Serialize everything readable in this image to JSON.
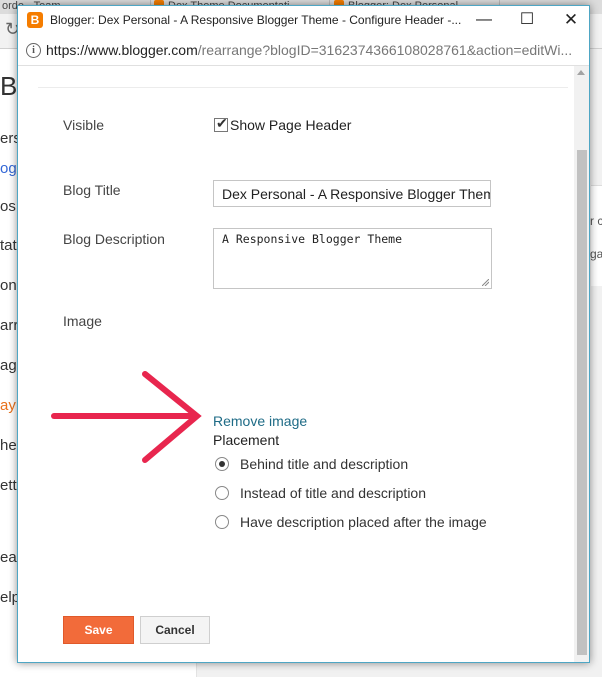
{
  "background": {
    "tabs": [
      "orde - Team",
      "Dex Theme Documentati",
      "Blogger: Dex Personal"
    ],
    "reload_icon": "reload-icon",
    "sidebar": {
      "title": "Bl",
      "items": [
        "ers",
        "og",
        "os",
        "tat",
        "on",
        "arr",
        "ag",
        "ay",
        "he",
        "ett",
        "ea",
        "elp"
      ]
    },
    "right_snippets": [
      "r c",
      "ga"
    ]
  },
  "popup": {
    "window_title": "Blogger: Dex Personal - A Responsive Blogger Theme - Configure Header -...",
    "url_host": "https://www.blogger.com",
    "url_path": "/rearrange?blogID=3162374366108028761&action=editWi...",
    "controls": {
      "minimize": "—",
      "maximize": "☐",
      "close": "✕"
    },
    "icons": {
      "favicon": "blogger-icon",
      "info": "info-icon"
    }
  },
  "form": {
    "visible_label": "Visible",
    "show_header_label": "Show Page Header",
    "show_header_checked": true,
    "blog_title_label": "Blog Title",
    "blog_title_value": "Dex Personal - A Responsive Blogger Theme",
    "blog_description_label": "Blog Description",
    "blog_description_value": "A Responsive Blogger Theme",
    "image_label": "Image",
    "remove_image_link": "Remove image",
    "placement_label": "Placement",
    "placement_options": [
      {
        "label": "Behind title and description",
        "checked": true
      },
      {
        "label": "Instead of title and description",
        "checked": false
      },
      {
        "label": "Have description placed after the image",
        "checked": false
      }
    ],
    "save_label": "Save",
    "cancel_label": "Cancel"
  },
  "annotation": {
    "arrow_color": "#e8264e"
  },
  "colors": {
    "accent_save": "#f26b3a",
    "link": "#1e6b86",
    "window_border": "#4ea6c4"
  }
}
